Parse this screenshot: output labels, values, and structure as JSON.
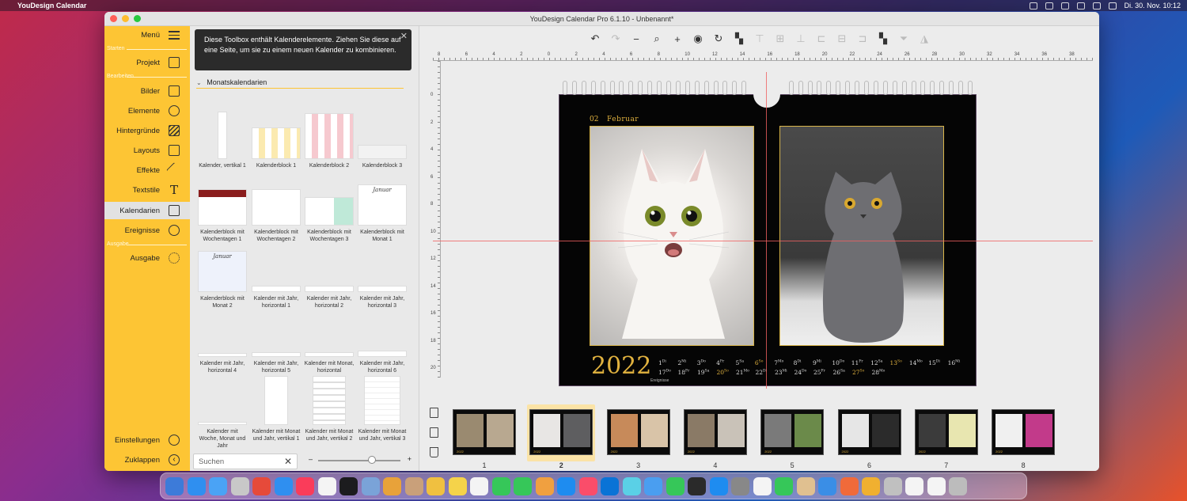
{
  "menubar": {
    "app_name": "YouDesign Calendar",
    "clock": "Di. 30. Nov.  10:12"
  },
  "window": {
    "title": "YouDesign Calendar Pro 6.1.10 - Unbenannt*"
  },
  "sidebar": {
    "menu_label": "Menü",
    "sections": {
      "start": "Starten",
      "edit": "Bearbeiten",
      "output": "Ausgabe"
    },
    "items": [
      {
        "label": "Projekt",
        "icon": "document-icon"
      },
      {
        "label": "Bilder",
        "icon": "image-icon"
      },
      {
        "label": "Elemente",
        "icon": "elements-icon"
      },
      {
        "label": "Hintergründe",
        "icon": "backgrounds-icon"
      },
      {
        "label": "Layouts",
        "icon": "layouts-icon"
      },
      {
        "label": "Effekte",
        "icon": "effects-icon"
      },
      {
        "label": "Textstile",
        "icon": "text-style-icon"
      },
      {
        "label": "Kalendarien",
        "icon": "calendar-icon"
      },
      {
        "label": "Ereignisse",
        "icon": "events-icon"
      },
      {
        "label": "Ausgabe",
        "icon": "output-icon"
      }
    ],
    "settings": "Einstellungen",
    "collapse": "Zuklappen"
  },
  "toolbox": {
    "hint": "Diese Toolbox enthält Kalenderelemente. Ziehen Sie diese auf eine Seite, um sie zu einem neuen Kalender zu kombinieren.",
    "section_title": "Monatskalendarien",
    "items": [
      [
        "Kalender, vertikal 1"
      ],
      [
        "Kalenderblock 1"
      ],
      [
        "Kalenderblock 2"
      ],
      [
        "Kalenderblock 3"
      ],
      [
        "Kalenderblock mit",
        "Wochentagen 1"
      ],
      [
        "Kalenderblock mit",
        "Wochentagen 2"
      ],
      [
        "Kalenderblock mit",
        "Wochentagen 3"
      ],
      [
        "Kalenderblock mit",
        "Monat 1"
      ],
      [
        "Kalenderblock mit",
        "Monat 2"
      ],
      [
        "Kalender mit Jahr,",
        "horizontal 1"
      ],
      [
        "Kalender mit Jahr,",
        "horizontal 2"
      ],
      [
        "Kalender mit Jahr,",
        "horizontal 3"
      ],
      [
        "Kalender mit Jahr,",
        "horizontal 4"
      ],
      [
        "Kalender mit Jahr,",
        "horizontal 5"
      ],
      [
        "Kalender mit Monat,",
        "horizontal"
      ],
      [
        "Kalender mit Jahr,",
        "horizontal 6"
      ],
      [
        "Kalender mit",
        "Woche, Monat und",
        "Jahr"
      ],
      [
        "Kalender mit Monat",
        "und Jahr, vertikal 1"
      ],
      [
        "Kalender mit Monat",
        "und Jahr, vertikal 2"
      ],
      [
        "Kalender mit Monat",
        "und Jahr, vertikal 3"
      ]
    ],
    "thumb_month_1": "Januar",
    "thumb_month_2": "Januar",
    "search_placeholder": "Suchen",
    "zoom_level": 0.65
  },
  "canvas": {
    "ruler_h_labels": [
      "8",
      "6",
      "4",
      "2",
      "0",
      "2",
      "4",
      "6",
      "8",
      "10",
      "12",
      "14",
      "16",
      "18",
      "20",
      "22",
      "24",
      "26",
      "28",
      "30",
      "32",
      "34",
      "36",
      "38"
    ],
    "ruler_v_labels": [
      "0",
      "2",
      "4",
      "6",
      "8",
      "10",
      "12",
      "14",
      "16",
      "18",
      "20"
    ],
    "month_num": "02",
    "month_name": "Februar",
    "year": "2022",
    "events_label": "Ereignisse",
    "days_row1": [
      {
        "n": "1",
        "s": "Di"
      },
      {
        "n": "2",
        "s": "Mi"
      },
      {
        "n": "3",
        "s": "Do"
      },
      {
        "n": "4",
        "s": "Fr"
      },
      {
        "n": "5",
        "s": "Sa"
      },
      {
        "n": "6",
        "s": "So"
      },
      {
        "n": "7",
        "s": "Mo"
      },
      {
        "n": "8",
        "s": "Di"
      },
      {
        "n": "9",
        "s": "Mi"
      },
      {
        "n": "10",
        "s": "Do"
      },
      {
        "n": "11",
        "s": "Fr"
      },
      {
        "n": "12",
        "s": "Sa"
      },
      {
        "n": "13",
        "s": "So"
      },
      {
        "n": "14",
        "s": "Mo"
      },
      {
        "n": "15",
        "s": "Di"
      },
      {
        "n": "16",
        "s": "Mi"
      }
    ],
    "days_row2": [
      {
        "n": "17",
        "s": "Do"
      },
      {
        "n": "18",
        "s": "Fr"
      },
      {
        "n": "19",
        "s": "Sa"
      },
      {
        "n": "20",
        "s": "So"
      },
      {
        "n": "21",
        "s": "Mo"
      },
      {
        "n": "22",
        "s": "Di"
      },
      {
        "n": "23",
        "s": "Mi"
      },
      {
        "n": "24",
        "s": "Do"
      },
      {
        "n": "25",
        "s": "Fr"
      },
      {
        "n": "26",
        "s": "Sa"
      },
      {
        "n": "27",
        "s": "So"
      },
      {
        "n": "28",
        "s": "Mo"
      }
    ],
    "weekend_days": [
      "6",
      "13",
      "20",
      "27"
    ]
  },
  "filmstrip": {
    "pages": [
      "1",
      "2",
      "3",
      "4",
      "5",
      "6",
      "7",
      "8"
    ],
    "selected": "2",
    "mini_year": "2022"
  },
  "colors": {
    "sidebar": "#fdc534",
    "gold": "#e1b23f",
    "guide": "#f06060"
  }
}
